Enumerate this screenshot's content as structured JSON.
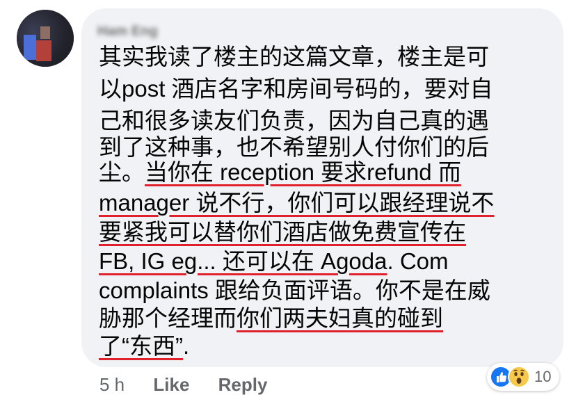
{
  "comment": {
    "author": "Ham Eng",
    "lines": [
      [
        "其实我读了楼主的这篇文章，楼主是可"
      ],
      [
        "以post 酒店名字和房间号码的，要对自"
      ],
      [
        "己和很多读友们负责，因为自己真的遇"
      ],
      [
        "到了这种事，也不希望别人付你们的后"
      ],
      [
        "尘。",
        "当你在 reception 要求refund 而"
      ],
      [
        "manager 说不行，你们可以跟经理说不"
      ],
      [
        "要紧我可以替你们酒店做免费宣传在"
      ],
      [
        "FB, IG eg... 还可以在 Agoda",
        ". Com"
      ],
      [
        "complaints 跟给负面评语。你不是在威"
      ],
      [
        "胁那个经理而",
        "你们两夫妇真的碰到"
      ],
      [
        "了“东西”",
        "."
      ]
    ]
  },
  "meta": {
    "time": "5 h",
    "like_label": "Like",
    "reply_label": "Reply"
  },
  "reactions": {
    "count": "10",
    "icons": [
      "like-icon",
      "wow-icon"
    ],
    "like_color": "#1877f2",
    "wow_color": "#f7c94a"
  },
  "colors": {
    "bubble": "#f0f2f5",
    "underline": "#e0202c",
    "meta_text": "#65676b"
  }
}
